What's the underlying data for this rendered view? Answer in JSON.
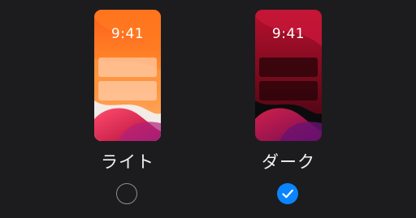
{
  "appearance": {
    "options": [
      {
        "id": "light",
        "label": "ライト",
        "clock": "9:41",
        "selected": false
      },
      {
        "id": "dark",
        "label": "ダーク",
        "clock": "9:41",
        "selected": true
      }
    ]
  },
  "colors": {
    "background": "#1c1c1e",
    "accent": "#0a84ff",
    "radio_border": "#8e8e93",
    "label_text": "#f2f2f2"
  },
  "icons": {
    "selected_indicator": "checkmark-icon"
  }
}
